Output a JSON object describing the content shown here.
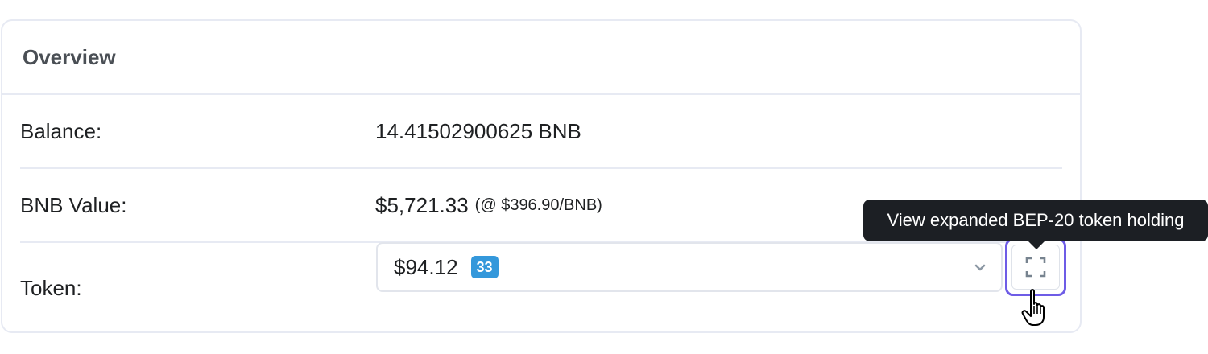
{
  "overview": {
    "title": "Overview",
    "balance": {
      "label": "Balance:",
      "value": "14.41502900625 BNB"
    },
    "bnb_value": {
      "label": "BNB Value:",
      "value": "$5,721.33",
      "rate": "(@ $396.90/BNB)"
    },
    "token": {
      "label": "Token:",
      "amount": "$94.12",
      "count_badge": "33",
      "expand_tooltip": "View expanded BEP-20 token holding"
    }
  },
  "colors": {
    "badge": "#3498db",
    "focus_ring": "#6e5ce6",
    "tooltip_bg": "#1c1f24"
  },
  "icons": {
    "expand": "expand-icon",
    "dropdown": "chevron-down-icon",
    "cursor": "hand-pointer-cursor"
  }
}
